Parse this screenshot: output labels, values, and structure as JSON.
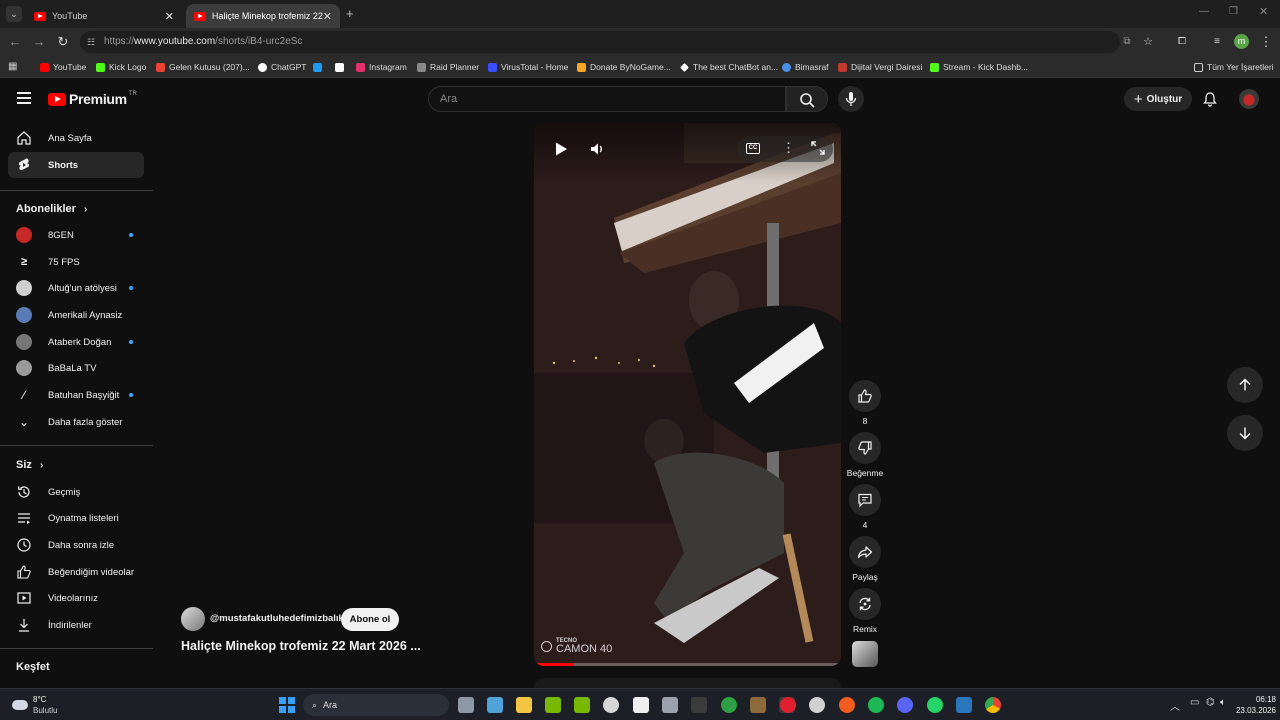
{
  "browser": {
    "tabs": [
      {
        "label": "YouTube"
      },
      {
        "label": "Haliçte Minekop trofemiz 22 M"
      }
    ],
    "url_prefix": "https://",
    "url_host": "www.youtube.com",
    "url_path": "/shorts/iB4-urc2eSc",
    "bookmarks": [
      {
        "label": "YouTube",
        "color": "#ff0000"
      },
      {
        "label": "Kick Logo",
        "color": "#53fc18"
      },
      {
        "label": "Gelen Kutusu (207)...",
        "color": "#ea4335"
      },
      {
        "label": "ChatGPT",
        "color": "#ffffff"
      },
      {
        "label": "",
        "color": "#1d9bf0"
      },
      {
        "label": "",
        "color": "#ffffff"
      },
      {
        "label": "Instagram",
        "color": "#e1306c"
      },
      {
        "label": "Raid Planner",
        "color": "#888888"
      },
      {
        "label": "VirusTotal - Home",
        "color": "#394eff"
      },
      {
        "label": "Donate ByNoGame...",
        "color": "#f5a623"
      },
      {
        "label": "The best ChatBot an...",
        "color": "#ffffff"
      },
      {
        "label": "Bimasraf",
        "color": "#4a90e2"
      },
      {
        "label": "Dijital Vergi Dairesi",
        "color": "#c0392b"
      },
      {
        "label": "Stream - Kick Dashb...",
        "color": "#53fc18"
      }
    ],
    "all_bookmarks": "Tüm Yer İşaretleri",
    "profile_initial": "m"
  },
  "header": {
    "brand": "Premium",
    "region": "TR",
    "search_placeholder": "Ara",
    "create_label": "Oluştur"
  },
  "sidebar": {
    "main": [
      {
        "label": "Ana Sayfa",
        "icon": "home-icon"
      },
      {
        "label": "Shorts",
        "icon": "shorts-icon",
        "active": true
      }
    ],
    "subs_title": "Abonelikler",
    "subs": [
      {
        "label": "8GEN",
        "dot": true,
        "color": "#c62828"
      },
      {
        "label": "75 FPS",
        "dot": false,
        "color": "#ffffff"
      },
      {
        "label": "Altuğ'un atölyesi",
        "dot": true,
        "color": "#cfcfcf"
      },
      {
        "label": "Amerikali Aynasiz",
        "dot": false,
        "color": "#5a7bb5"
      },
      {
        "label": "Ataberk Doğan",
        "dot": true,
        "color": "#777777"
      },
      {
        "label": "BaBaLa TV",
        "dot": false,
        "color": "#999999"
      },
      {
        "label": "Batuhan Başyiğit",
        "dot": true,
        "color": "#ffffff"
      }
    ],
    "show_more": "Daha fazla göster",
    "you_title": "Siz",
    "you": [
      {
        "label": "Geçmiş",
        "icon": "history-icon"
      },
      {
        "label": "Oynatma listeleri",
        "icon": "playlists-icon"
      },
      {
        "label": "Daha sonra izle",
        "icon": "watch-later-icon"
      },
      {
        "label": "Beğendiğim videolar",
        "icon": "liked-icon"
      },
      {
        "label": "Videolarınız",
        "icon": "your-videos-icon"
      },
      {
        "label": "İndirilenler",
        "icon": "downloads-icon"
      }
    ],
    "explore_title": "Keşfet"
  },
  "short": {
    "channel": "@mustafakutluhedefimizbalık",
    "subscribe_label": "Abone ol",
    "title": "Haliçte Minekop trofemiz 22 Mart 2026 ...",
    "watermark_brand": "TECNO",
    "watermark_model": "CAMON 40",
    "progress": 0.13,
    "actions": [
      {
        "label": "8",
        "icon": "like-icon"
      },
      {
        "label": "Beğenme",
        "icon": "dislike-icon"
      },
      {
        "label": "4",
        "icon": "comment-icon"
      },
      {
        "label": "Paylaş",
        "icon": "share-icon"
      },
      {
        "label": "Remix",
        "icon": "remix-icon"
      }
    ]
  },
  "taskbar": {
    "weather_temp": "8°C",
    "weather_desc": "Bulutlu",
    "search_label": "Ara",
    "time": "06:18",
    "date": "23.03.2026"
  }
}
